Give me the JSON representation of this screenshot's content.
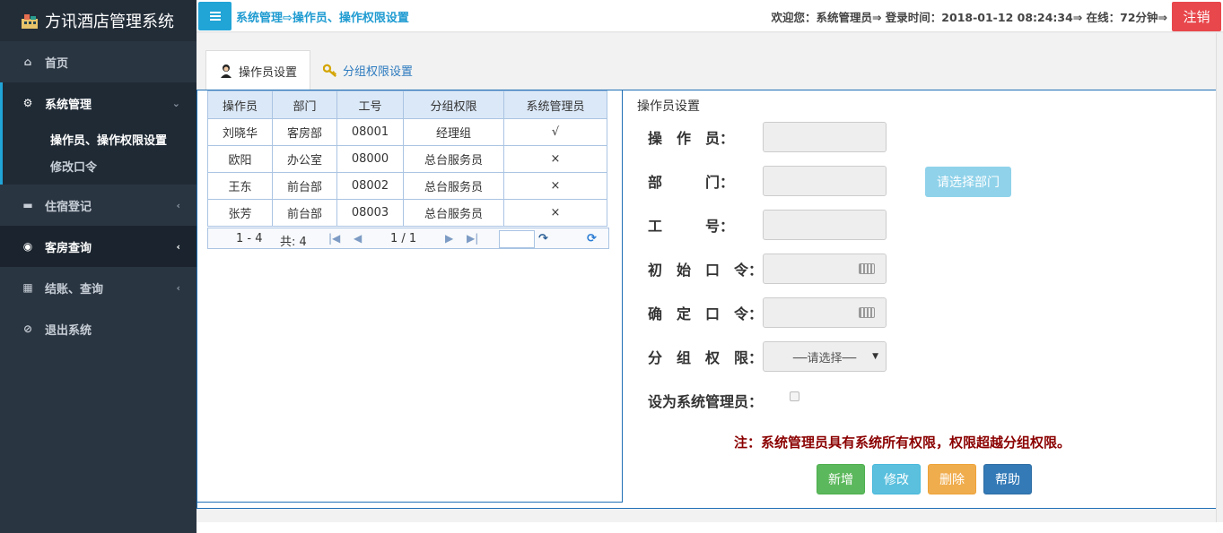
{
  "app": {
    "title": "方讯酒店管理系统"
  },
  "sidebar": {
    "items": [
      {
        "label": "首页",
        "icon": "home-icon"
      },
      {
        "label": "系统管理",
        "icon": "gear-icon",
        "expanded": true,
        "children": [
          {
            "label": "操作员、操作权限设置",
            "current": true
          },
          {
            "label": "修改口令"
          }
        ]
      },
      {
        "label": "住宿登记",
        "icon": "bed-icon"
      },
      {
        "label": "客房查询",
        "icon": "eye-icon"
      },
      {
        "label": "结账、查询",
        "icon": "calculator-icon"
      },
      {
        "label": "退出系统",
        "icon": "ban-icon"
      }
    ]
  },
  "topbar": {
    "breadcrumb": "系统管理⇨操作员、操作权限设置",
    "welcome": "欢迎您：系统管理员⇒ 登录时间：2018-01-12 08:24:34⇒ 在线：72分钟⇒",
    "logout_label": "注销"
  },
  "tabs": [
    {
      "label": "操作员设置",
      "icon": "user-icon",
      "active": true
    },
    {
      "label": "分组权限设置",
      "icon": "key-icon",
      "active": false
    }
  ],
  "grid": {
    "columns": [
      "操作员",
      "部门",
      "工号",
      "分组权限",
      "系统管理员"
    ],
    "rows": [
      [
        "刘晓华",
        "客房部",
        "08001",
        "经理组",
        "√"
      ],
      [
        "欧阳",
        "办公室",
        "08000",
        "总台服务员",
        "×"
      ],
      [
        "王东",
        "前台部",
        "08002",
        "总台服务员",
        "×"
      ],
      [
        "张芳",
        "前台部",
        "08003",
        "总台服务员",
        "×"
      ]
    ],
    "pager": {
      "range": "1 - 4",
      "total": "共: 4",
      "page": "1 / 1"
    }
  },
  "form": {
    "title": "操作员设置",
    "labels": {
      "operator": "操　作　员：",
      "dept": "部　　　门：",
      "empno": "工　　　号：",
      "init_pwd": "初　始　口　令：",
      "confirm_pwd": "确　定　口　令：",
      "group": "分　组　权　限：",
      "set_admin": "设为系统管理员："
    },
    "choose_dept_label": "请选择部门",
    "group_select_value": "──请选择──",
    "note": "注：系统管理员具有系统所有权限，权限超越分组权限。",
    "buttons": {
      "add": "新增",
      "edit": "修改",
      "delete": "删除",
      "help": "帮助"
    }
  },
  "colors": {
    "accent": "#21a4d6",
    "logout": "#e8474c",
    "note": "#8b0000",
    "sidebar": "#2a3542"
  }
}
